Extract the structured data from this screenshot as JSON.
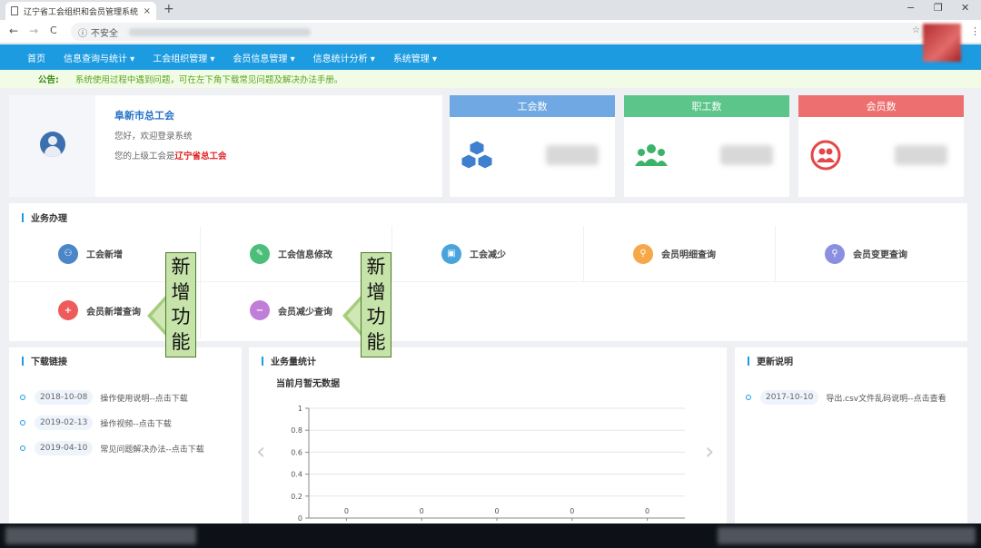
{
  "browser": {
    "tab_title": "辽宁省工会组织和会员管理系统",
    "tab_close": "×",
    "new_tab": "+",
    "security_label": "不安全",
    "back": "←",
    "forward": "→",
    "reload": "C",
    "info": "ⓘ",
    "minimize": "−",
    "restore": "❐",
    "close": "✕",
    "menu": "⋮"
  },
  "nav": {
    "items": [
      "首页",
      "信息查询与统计 ▾",
      "工会组织管理 ▾",
      "会员信息管理 ▾",
      "信息统计分析 ▾",
      "系统管理 ▾"
    ]
  },
  "notice": {
    "label": "公告:",
    "text": "系统使用过程中遇到问题，可在左下角下载常见问题及解决办法手册。"
  },
  "profile": {
    "org_name": "阜新市总工会",
    "welcome": "您好，欢迎登录系统",
    "superior_prefix": "您的上级工会是",
    "superior_name": "辽宁省总工会"
  },
  "stats": [
    {
      "label": "工会数",
      "color": "#6fa8e3",
      "icon": "cubes-icon"
    },
    {
      "label": "职工数",
      "color": "#5cc68a",
      "icon": "users-icon"
    },
    {
      "label": "会员数",
      "color": "#ee6f6f",
      "icon": "member-icon"
    }
  ],
  "business": {
    "title": "业务办理",
    "items": [
      {
        "label": "工会新增",
        "color": "#4a86c8",
        "glyph": "⚇"
      },
      {
        "label": "工会信息修改",
        "color": "#4bbf7a",
        "glyph": "✎"
      },
      {
        "label": "工会减少",
        "color": "#4aa4dc",
        "glyph": "▣"
      },
      {
        "label": "会员明细查询",
        "color": "#f5a847",
        "glyph": "⚲"
      },
      {
        "label": "会员变更查询",
        "color": "#8a8fe0",
        "glyph": "⚲"
      },
      {
        "label": "会员新增查询",
        "color": "#ef5a5a",
        "glyph": "+"
      },
      {
        "label": "会员减少查询",
        "color": "#c07ed8",
        "glyph": "−"
      }
    ]
  },
  "annotations": [
    {
      "chars": [
        "新",
        "增",
        "功",
        "能"
      ]
    },
    {
      "chars": [
        "新",
        "增",
        "功",
        "能"
      ]
    }
  ],
  "downloads": {
    "title": "下载链接",
    "items": [
      {
        "date": "2018-10-08",
        "text": "操作使用说明--点击下载"
      },
      {
        "date": "2019-02-13",
        "text": "操作视频--点击下载"
      },
      {
        "date": "2019-04-10",
        "text": "常见问题解决办法--点击下载"
      }
    ]
  },
  "business_stats": {
    "title": "业务量统计",
    "chart_title": "当前月暂无数据",
    "prev": "‹",
    "next": "›"
  },
  "updates": {
    "title": "更新说明",
    "items": [
      {
        "date": "2017-10-10",
        "text": "导出.csv文件乱码说明--点击查看"
      }
    ]
  },
  "chart_data": {
    "type": "bar",
    "title": "当前月暂无数据",
    "categories": [
      "",
      "",
      "",
      "",
      ""
    ],
    "values": [
      0,
      0,
      0,
      0,
      0
    ],
    "ylim": [
      0,
      1
    ],
    "yticks": [
      0,
      0.2,
      0.4,
      0.6,
      0.8,
      1
    ],
    "grid": true
  }
}
